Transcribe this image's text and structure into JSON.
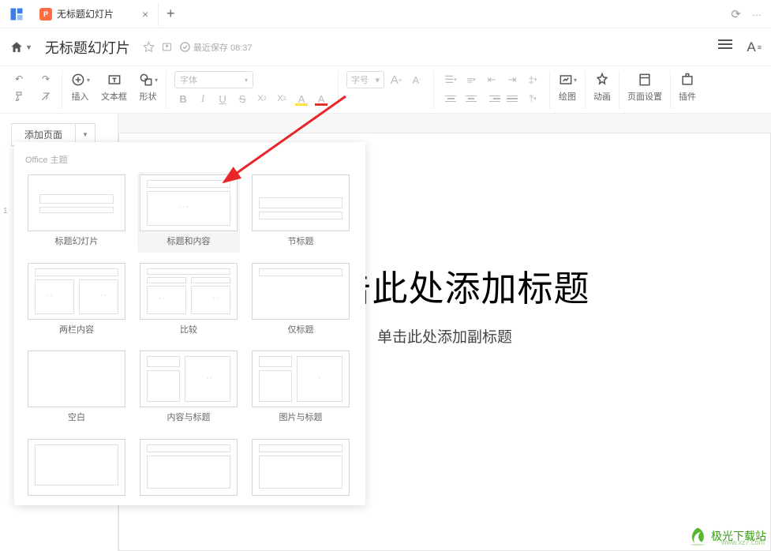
{
  "titlebar": {
    "tab_title": "无标题幻灯片"
  },
  "docbar": {
    "title": "无标题幻灯片",
    "autosave": "最近保存 08:37",
    "aa_label": "A"
  },
  "toolbar": {
    "insert": "插入",
    "textbox": "文本框",
    "shape": "形状",
    "font_placeholder": "字体",
    "size_placeholder": "字号",
    "bold": "B",
    "italic": "I",
    "underline": "U",
    "strike": "S",
    "sup": "X²",
    "sub": "X₂",
    "hl": "A",
    "color": "A",
    "a_plus": "A",
    "a_minus": "A",
    "draw": "绘图",
    "anim": "动画",
    "page": "页面设置",
    "plugin": "插件"
  },
  "leftpanel": {
    "add_page": "添加页面",
    "slide_num": "1"
  },
  "dropdown": {
    "header": "Office 主题",
    "layouts": [
      {
        "name": "标题幻灯片"
      },
      {
        "name": "标题和内容"
      },
      {
        "name": "节标题"
      },
      {
        "name": "两栏内容"
      },
      {
        "name": "比较"
      },
      {
        "name": "仅标题"
      },
      {
        "name": "空白"
      },
      {
        "name": "内容与标题"
      },
      {
        "name": "图片与标题"
      },
      {
        "name": ""
      },
      {
        "name": ""
      },
      {
        "name": ""
      }
    ]
  },
  "slide": {
    "title_placeholder": "单击此处添加标题",
    "subtitle_placeholder": "单击此处添加副标题"
  },
  "watermark": {
    "text": "极光下载站",
    "url": "www.xz7.com"
  }
}
